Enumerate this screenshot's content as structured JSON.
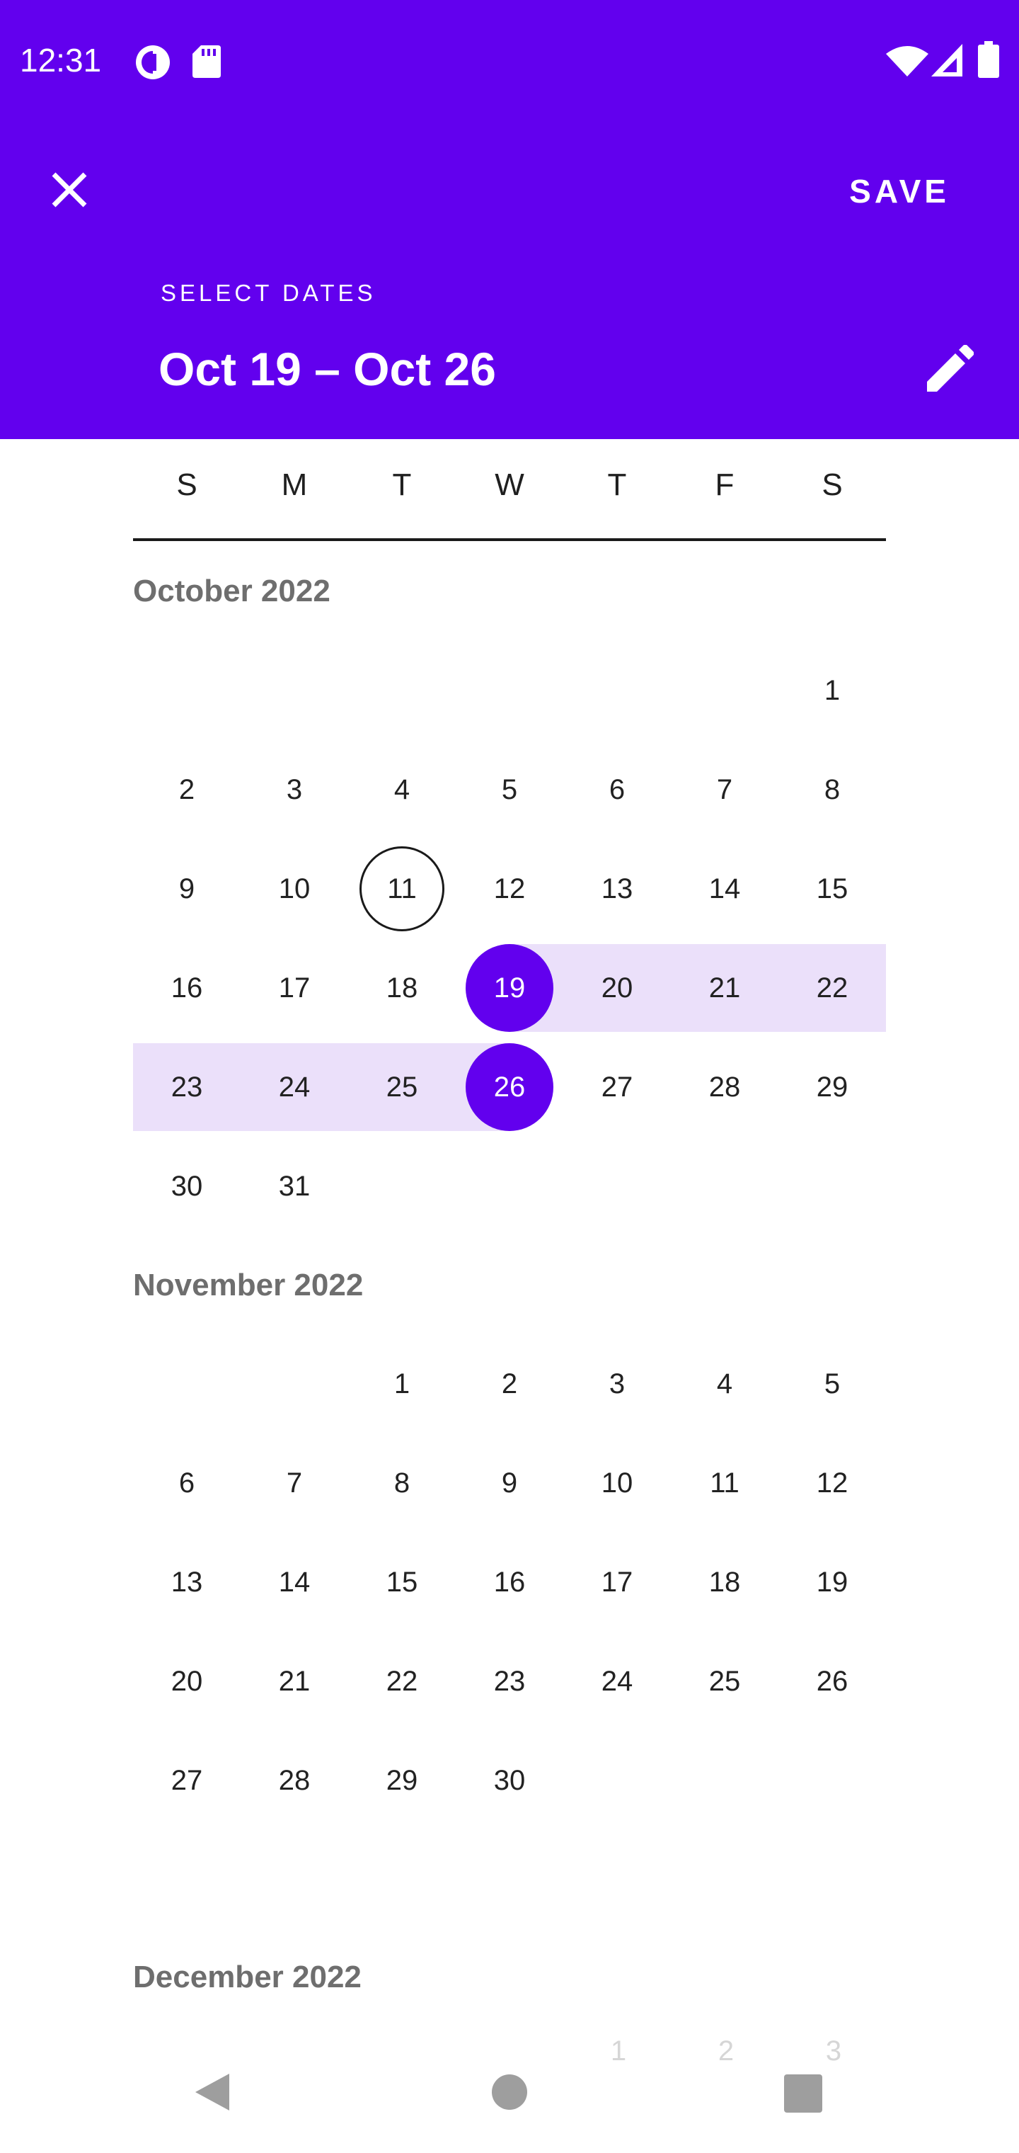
{
  "status_bar": {
    "time": "12:31"
  },
  "header": {
    "save_label": "SAVE",
    "select_label": "SELECT DATES",
    "range_title": "Oct 19 – Oct 26"
  },
  "weekdays": [
    "S",
    "M",
    "T",
    "W",
    "T",
    "F",
    "S"
  ],
  "months": [
    {
      "title": "October 2022",
      "weeks": [
        [
          "",
          "",
          "",
          "",
          "",
          "",
          "1"
        ],
        [
          "2",
          "3",
          "4",
          "5",
          "6",
          "7",
          "8"
        ],
        [
          "9",
          "10",
          "11",
          "12",
          "13",
          "14",
          "15"
        ],
        [
          "16",
          "17",
          "18",
          "19",
          "20",
          "21",
          "22"
        ],
        [
          "23",
          "24",
          "25",
          "26",
          "27",
          "28",
          "29"
        ],
        [
          "30",
          "31",
          "",
          "",
          "",
          "",
          ""
        ]
      ],
      "today": "11",
      "range_start": "19",
      "range_end": "26"
    },
    {
      "title": "November 2022",
      "weeks": [
        [
          "",
          "",
          "1",
          "2",
          "3",
          "4",
          "5"
        ],
        [
          "6",
          "7",
          "8",
          "9",
          "10",
          "11",
          "12"
        ],
        [
          "13",
          "14",
          "15",
          "16",
          "17",
          "18",
          "19"
        ],
        [
          "20",
          "21",
          "22",
          "23",
          "24",
          "25",
          "26"
        ],
        [
          "27",
          "28",
          "29",
          "30",
          "",
          "",
          ""
        ]
      ]
    },
    {
      "title": "December 2022",
      "partial_days": [
        "1",
        "2",
        "3"
      ]
    }
  ],
  "colors": {
    "accent": "#6200ee",
    "range_band": "#ebe0fa"
  },
  "icons": {
    "status": [
      "data-saver-icon",
      "sd-card-icon",
      "wifi-icon",
      "cell-signal-icon",
      "battery-icon"
    ],
    "header": [
      "close-icon",
      "edit-pencil-icon"
    ],
    "nav": [
      "back-icon",
      "home-icon",
      "recents-icon"
    ]
  }
}
